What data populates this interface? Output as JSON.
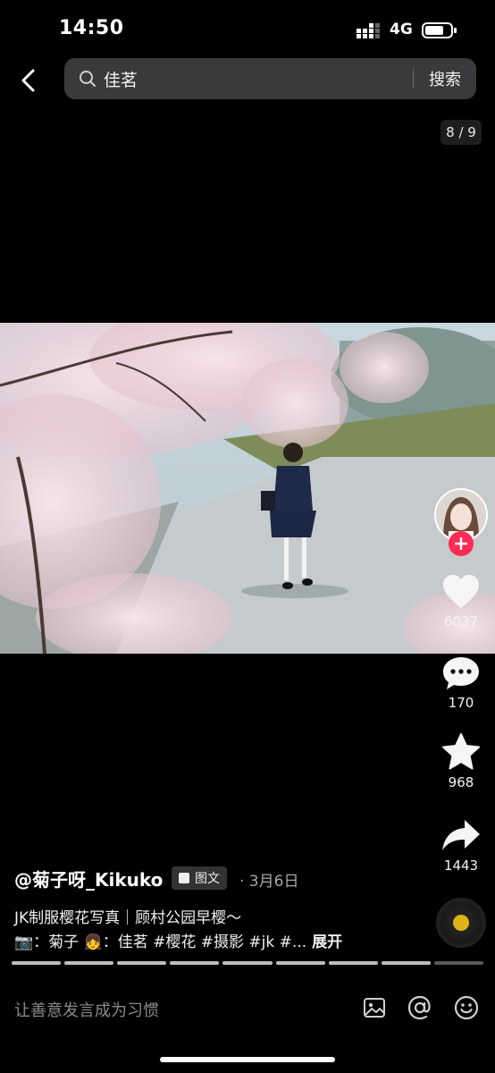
{
  "status_bar": {
    "time": "14:50",
    "network": "4G",
    "icons": [
      "signal-icon",
      "battery-icon"
    ]
  },
  "header": {
    "query": "佳茗",
    "search_button": "搜索",
    "icons": [
      "back-icon",
      "search-icon"
    ]
  },
  "page_counter": "8 / 9",
  "actions": {
    "likes": "6037",
    "comments": "170",
    "favorites": "968",
    "shares": "1443",
    "icons": [
      "heart-icon",
      "comment-icon",
      "star-icon",
      "share-icon",
      "plus-icon"
    ]
  },
  "post": {
    "author": "@菊子呀_Kikuko",
    "type_badge": "图文",
    "date": "· 3月6日",
    "title": "JK制服樱花写真｜顾村公园早樱～",
    "tags": "📷：菊子 👧：佳茗 #樱花 #摄影 #jk #...",
    "expand": "展开"
  },
  "progress": {
    "total": 9,
    "current": 8
  },
  "comment_bar": {
    "placeholder": "让善意发言成为习惯",
    "icons": [
      "image-icon",
      "at-icon",
      "emoji-icon"
    ]
  },
  "colors": {
    "background": "#000000",
    "accent": "#fe2c55",
    "search_bg": "#3a3a3c"
  }
}
